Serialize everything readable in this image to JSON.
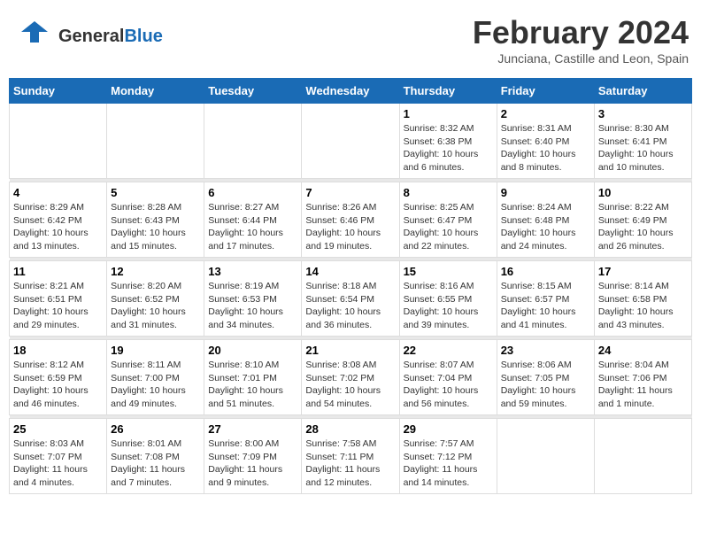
{
  "header": {
    "logo_general": "General",
    "logo_blue": "Blue",
    "main_title": "February 2024",
    "sub_title": "Junciana, Castille and Leon, Spain"
  },
  "days_of_week": [
    "Sunday",
    "Monday",
    "Tuesday",
    "Wednesday",
    "Thursday",
    "Friday",
    "Saturday"
  ],
  "weeks": [
    [
      {
        "day": "",
        "info": ""
      },
      {
        "day": "",
        "info": ""
      },
      {
        "day": "",
        "info": ""
      },
      {
        "day": "",
        "info": ""
      },
      {
        "day": "1",
        "info": "Sunrise: 8:32 AM\nSunset: 6:38 PM\nDaylight: 10 hours\nand 6 minutes."
      },
      {
        "day": "2",
        "info": "Sunrise: 8:31 AM\nSunset: 6:40 PM\nDaylight: 10 hours\nand 8 minutes."
      },
      {
        "day": "3",
        "info": "Sunrise: 8:30 AM\nSunset: 6:41 PM\nDaylight: 10 hours\nand 10 minutes."
      }
    ],
    [
      {
        "day": "4",
        "info": "Sunrise: 8:29 AM\nSunset: 6:42 PM\nDaylight: 10 hours\nand 13 minutes."
      },
      {
        "day": "5",
        "info": "Sunrise: 8:28 AM\nSunset: 6:43 PM\nDaylight: 10 hours\nand 15 minutes."
      },
      {
        "day": "6",
        "info": "Sunrise: 8:27 AM\nSunset: 6:44 PM\nDaylight: 10 hours\nand 17 minutes."
      },
      {
        "day": "7",
        "info": "Sunrise: 8:26 AM\nSunset: 6:46 PM\nDaylight: 10 hours\nand 19 minutes."
      },
      {
        "day": "8",
        "info": "Sunrise: 8:25 AM\nSunset: 6:47 PM\nDaylight: 10 hours\nand 22 minutes."
      },
      {
        "day": "9",
        "info": "Sunrise: 8:24 AM\nSunset: 6:48 PM\nDaylight: 10 hours\nand 24 minutes."
      },
      {
        "day": "10",
        "info": "Sunrise: 8:22 AM\nSunset: 6:49 PM\nDaylight: 10 hours\nand 26 minutes."
      }
    ],
    [
      {
        "day": "11",
        "info": "Sunrise: 8:21 AM\nSunset: 6:51 PM\nDaylight: 10 hours\nand 29 minutes."
      },
      {
        "day": "12",
        "info": "Sunrise: 8:20 AM\nSunset: 6:52 PM\nDaylight: 10 hours\nand 31 minutes."
      },
      {
        "day": "13",
        "info": "Sunrise: 8:19 AM\nSunset: 6:53 PM\nDaylight: 10 hours\nand 34 minutes."
      },
      {
        "day": "14",
        "info": "Sunrise: 8:18 AM\nSunset: 6:54 PM\nDaylight: 10 hours\nand 36 minutes."
      },
      {
        "day": "15",
        "info": "Sunrise: 8:16 AM\nSunset: 6:55 PM\nDaylight: 10 hours\nand 39 minutes."
      },
      {
        "day": "16",
        "info": "Sunrise: 8:15 AM\nSunset: 6:57 PM\nDaylight: 10 hours\nand 41 minutes."
      },
      {
        "day": "17",
        "info": "Sunrise: 8:14 AM\nSunset: 6:58 PM\nDaylight: 10 hours\nand 43 minutes."
      }
    ],
    [
      {
        "day": "18",
        "info": "Sunrise: 8:12 AM\nSunset: 6:59 PM\nDaylight: 10 hours\nand 46 minutes."
      },
      {
        "day": "19",
        "info": "Sunrise: 8:11 AM\nSunset: 7:00 PM\nDaylight: 10 hours\nand 49 minutes."
      },
      {
        "day": "20",
        "info": "Sunrise: 8:10 AM\nSunset: 7:01 PM\nDaylight: 10 hours\nand 51 minutes."
      },
      {
        "day": "21",
        "info": "Sunrise: 8:08 AM\nSunset: 7:02 PM\nDaylight: 10 hours\nand 54 minutes."
      },
      {
        "day": "22",
        "info": "Sunrise: 8:07 AM\nSunset: 7:04 PM\nDaylight: 10 hours\nand 56 minutes."
      },
      {
        "day": "23",
        "info": "Sunrise: 8:06 AM\nSunset: 7:05 PM\nDaylight: 10 hours\nand 59 minutes."
      },
      {
        "day": "24",
        "info": "Sunrise: 8:04 AM\nSunset: 7:06 PM\nDaylight: 11 hours\nand 1 minute."
      }
    ],
    [
      {
        "day": "25",
        "info": "Sunrise: 8:03 AM\nSunset: 7:07 PM\nDaylight: 11 hours\nand 4 minutes."
      },
      {
        "day": "26",
        "info": "Sunrise: 8:01 AM\nSunset: 7:08 PM\nDaylight: 11 hours\nand 7 minutes."
      },
      {
        "day": "27",
        "info": "Sunrise: 8:00 AM\nSunset: 7:09 PM\nDaylight: 11 hours\nand 9 minutes."
      },
      {
        "day": "28",
        "info": "Sunrise: 7:58 AM\nSunset: 7:11 PM\nDaylight: 11 hours\nand 12 minutes."
      },
      {
        "day": "29",
        "info": "Sunrise: 7:57 AM\nSunset: 7:12 PM\nDaylight: 11 hours\nand 14 minutes."
      },
      {
        "day": "",
        "info": ""
      },
      {
        "day": "",
        "info": ""
      }
    ]
  ]
}
